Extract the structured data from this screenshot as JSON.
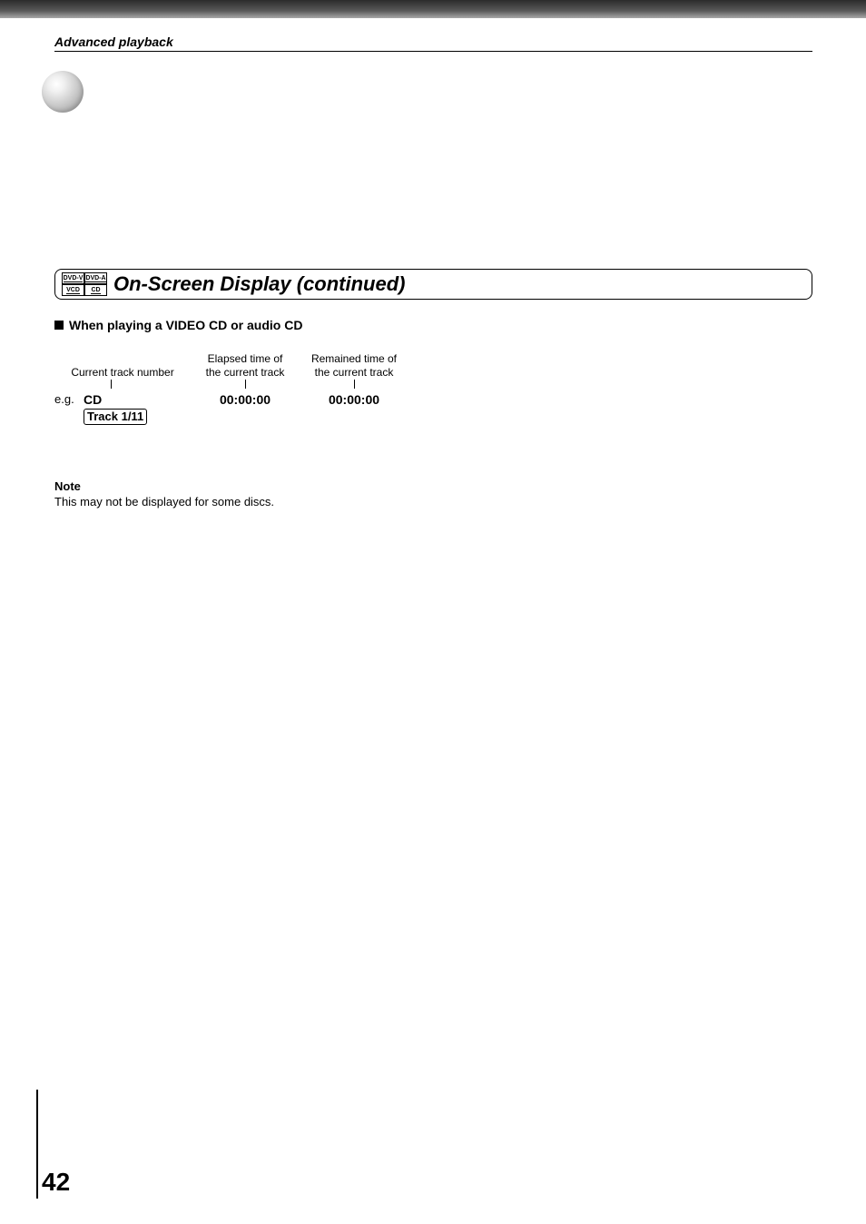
{
  "breadcrumb": "Advanced playback",
  "badges": {
    "tl": "DVD-V",
    "tr": "DVD-A",
    "bl": "VCD",
    "br": "CD"
  },
  "title": "On-Screen Display (continued)",
  "subheading": "When playing a VIDEO CD or audio CD",
  "labels": {
    "track_number": "Current track number",
    "elapsed_l1": "Elapsed time of",
    "elapsed_l2": "the current track",
    "remained_l1": "Remained time of",
    "remained_l2": "the current track"
  },
  "example": {
    "prefix": "e.g.",
    "disc_type": "CD",
    "track": "Track 1/11",
    "elapsed": "00:00:00",
    "remained": "00:00:00"
  },
  "note": {
    "heading": "Note",
    "body": "This may not be displayed for some discs."
  },
  "page_number": "42"
}
